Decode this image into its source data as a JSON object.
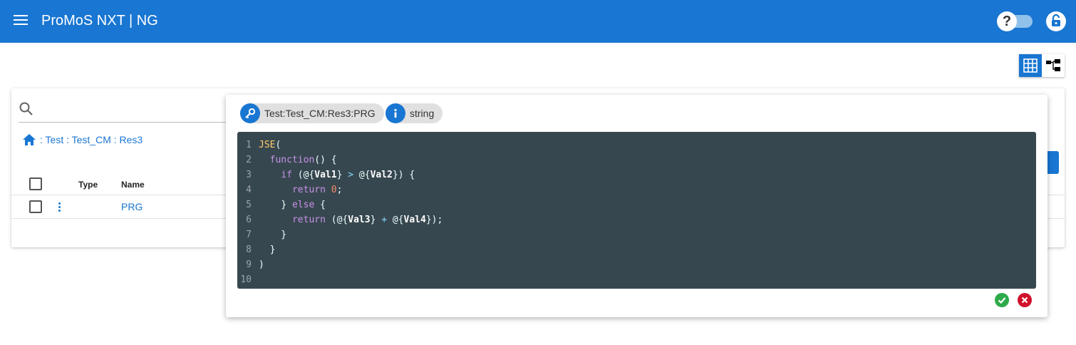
{
  "header": {
    "title": "ProMoS NXT | NG",
    "help_label": "?"
  },
  "breadcrumb": {
    "items": [
      ": Test",
      ": Test_CM",
      ": Res3"
    ]
  },
  "table": {
    "columns": [
      "Type",
      "Name"
    ],
    "rows": [
      {
        "type": "",
        "name": "PRG"
      }
    ]
  },
  "editor": {
    "key_chip": "Test:Test_CM:Res3:PRG",
    "type_chip": "string",
    "line_numbers": [
      "1",
      "2",
      "3",
      "4",
      "5",
      "6",
      "7",
      "8",
      "9",
      "10"
    ],
    "code": {
      "l1_fn": "JSE",
      "l1_p": "(",
      "l2_ind": "  ",
      "l2_kw": "function",
      "l2_p": "() {",
      "l3_ind": "    ",
      "l3_kw": "if",
      "l3_p1": " (@{",
      "l3_v1": "Val1",
      "l3_p2": "} ",
      "l3_op": ">",
      "l3_p3": " @{",
      "l3_v2": "Val2",
      "l3_p4": "}) {",
      "l4_ind": "      ",
      "l4_kw": "return",
      "l4_sp": " ",
      "l4_n": "0",
      "l4_p": ";",
      "l5_ind": "    ",
      "l5_p1": "} ",
      "l5_kw": "else",
      "l5_p2": " {",
      "l6_ind": "      ",
      "l6_kw": "return",
      "l6_p1": " (@{",
      "l6_v1": "Val3",
      "l6_p2": "} ",
      "l6_op": "+",
      "l6_p3": " @{",
      "l6_v2": "Val4",
      "l6_p4": "});",
      "l7": "    }",
      "l8": "  }",
      "l9": ")",
      "l10": ""
    }
  },
  "colors": {
    "primary": "#1976d2",
    "code_bg": "#37474f",
    "ok": "#2eaa4a",
    "cancel": "#d0112b"
  }
}
